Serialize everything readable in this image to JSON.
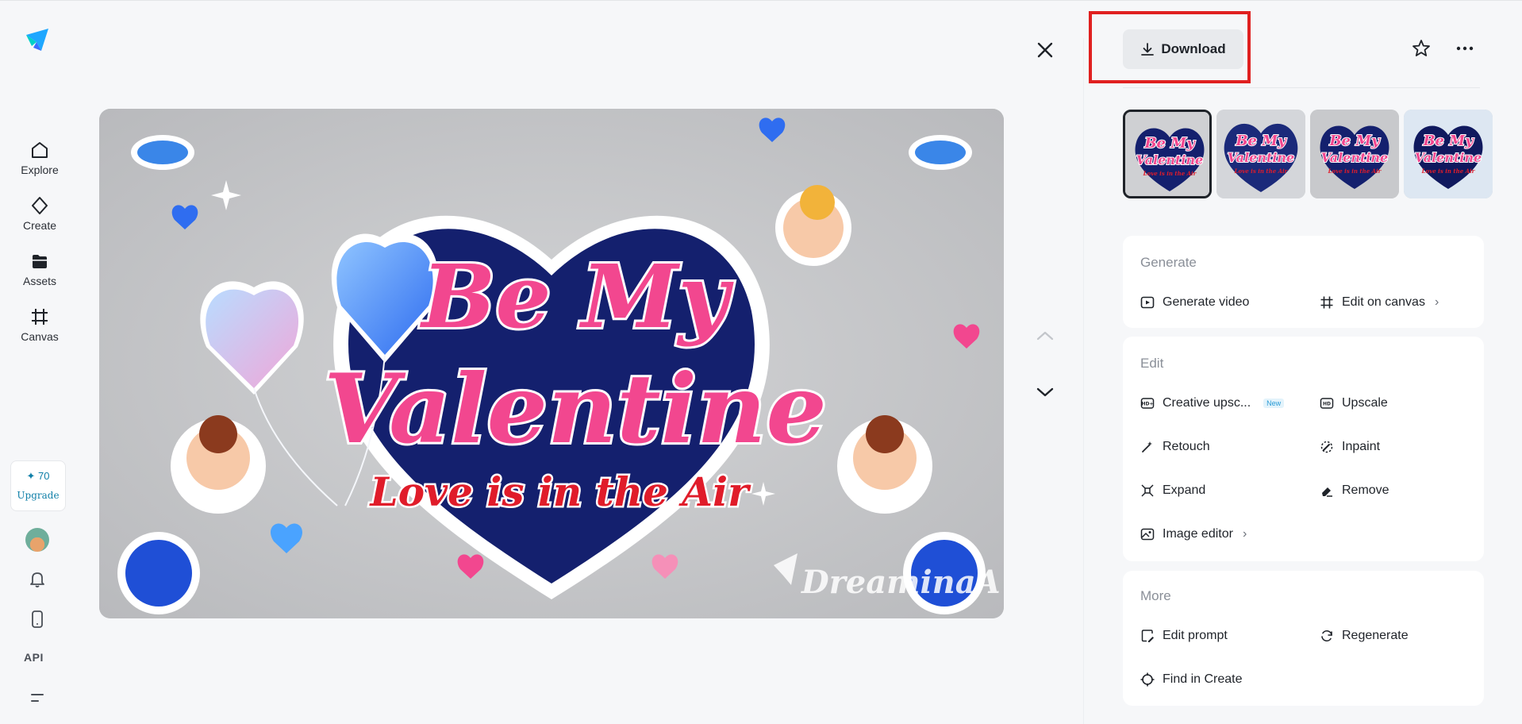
{
  "nav": {
    "items": [
      {
        "label": "Explore",
        "icon": "home-icon"
      },
      {
        "label": "Create",
        "icon": "diamond-icon"
      },
      {
        "label": "Assets",
        "icon": "folder-icon"
      },
      {
        "label": "Canvas",
        "icon": "canvas-icon"
      }
    ],
    "credits": {
      "amount": "✦ 70",
      "upgrade_label": "Upgrade"
    },
    "api_label": "API"
  },
  "image": {
    "headline_top": "Be My",
    "headline_main": "Valentine",
    "tagline": "Love is in the Air",
    "watermark": "DreaminaA"
  },
  "toolbar": {
    "download_label": "Download"
  },
  "thumbnails": [
    {
      "line1": "Be My",
      "line2": "Valentine",
      "line3": "Love is in the Air",
      "selected": true
    },
    {
      "line1": "Be My",
      "line2": "Valentine",
      "line3": "Love is in the Air",
      "selected": false
    },
    {
      "line1": "Be My",
      "line2": "Valentine",
      "line3": "Love is in the Air",
      "selected": false
    },
    {
      "line1": "Be My",
      "line2": "Valentine",
      "line3": "Love is in the Air",
      "selected": false
    }
  ],
  "panels": {
    "generate": {
      "title": "Generate",
      "actions": [
        {
          "label": "Generate video",
          "icon": "play-square-icon"
        },
        {
          "label": "Edit on canvas",
          "icon": "canvas-icon"
        }
      ]
    },
    "edit": {
      "title": "Edit",
      "actions": [
        {
          "label": "Creative upsc...",
          "icon": "hd-plus-icon",
          "badge": "New"
        },
        {
          "label": "Upscale",
          "icon": "hd-icon"
        },
        {
          "label": "Retouch",
          "icon": "magic-wand-icon"
        },
        {
          "label": "Inpaint",
          "icon": "brush-icon"
        },
        {
          "label": "Expand",
          "icon": "expand-icon"
        },
        {
          "label": "Remove",
          "icon": "eraser-icon"
        },
        {
          "label": "Image editor",
          "icon": "image-edit-icon"
        }
      ]
    },
    "more": {
      "title": "More",
      "actions": [
        {
          "label": "Edit prompt",
          "icon": "edit-prompt-icon"
        },
        {
          "label": "Regenerate",
          "icon": "refresh-icon"
        },
        {
          "label": "Find in Create",
          "icon": "target-icon"
        }
      ]
    }
  },
  "colors": {
    "accent": "#0f7fa8",
    "highlight_border": "#e02020",
    "heart_navy": "#14206e",
    "title_pink": "#f2478f",
    "tagline_red": "#e01c2a"
  }
}
